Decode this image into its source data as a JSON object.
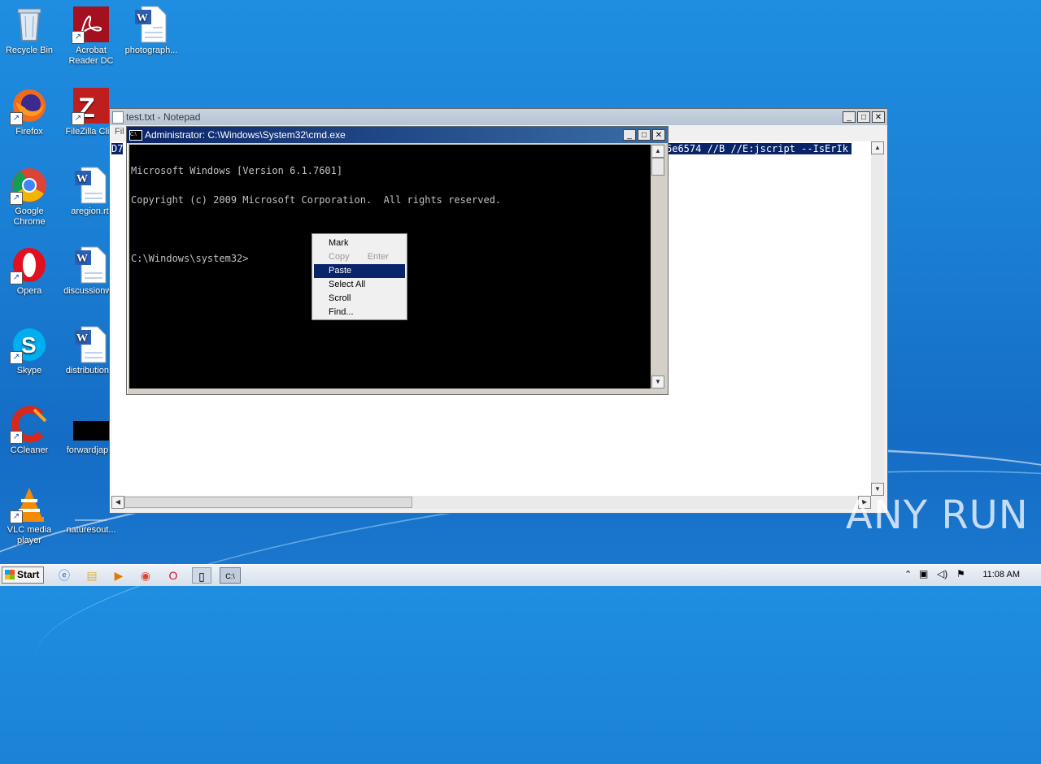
{
  "desktop_icons": [
    {
      "label": "Recycle Bin"
    },
    {
      "label": "Acrobat Reader DC"
    },
    {
      "label": "photograph..."
    },
    {
      "label": "Firefox"
    },
    {
      "label": "FileZilla Cli..."
    },
    {
      "label": "Google Chrome"
    },
    {
      "label": "aregion.rtf"
    },
    {
      "label": "Opera"
    },
    {
      "label": "discussionw..."
    },
    {
      "label": "Skype"
    },
    {
      "label": "distribution..."
    },
    {
      "label": "CCleaner"
    },
    {
      "label": "forwardjap..."
    },
    {
      "label": "VLC media player"
    },
    {
      "label": "naturesout..."
    }
  ],
  "notepad": {
    "title": "test.txt - Notepad",
    "menu_hint": "Fil",
    "text_left": "D7",
    "text_right": "6e6574 //B //E:jscript --IsErIk"
  },
  "cmd": {
    "title": "Administrator: C:\\Windows\\System32\\cmd.exe",
    "line1": "Microsoft Windows [Version 6.1.7601]",
    "line2": "Copyright (c) 2009 Microsoft Corporation.  All rights reserved.",
    "line3": "C:\\Windows\\system32>"
  },
  "context_menu": {
    "mark": "Mark",
    "copy": "Copy",
    "copy_key": "Enter",
    "paste": "Paste",
    "select_all": "Select All",
    "scroll": "Scroll",
    "find": "Find..."
  },
  "taskbar": {
    "start_label": "Start",
    "clock": "11:08 AM"
  },
  "watermark": "ANY RUN",
  "colors": {
    "desktop": "#1a7fd4",
    "menu_highlight": "#0a246a",
    "cmd_title_active": "#0a246a"
  }
}
